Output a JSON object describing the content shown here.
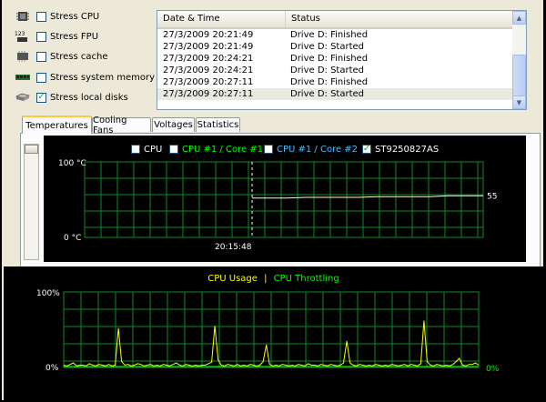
{
  "stress": {
    "items": [
      {
        "label": "Stress CPU",
        "checked": false,
        "icon": "cpu-chip-icon"
      },
      {
        "label": "Stress FPU",
        "checked": false,
        "icon": "fpu-icon"
      },
      {
        "label": "Stress cache",
        "checked": false,
        "icon": "cache-chip-icon"
      },
      {
        "label": "Stress system memory",
        "checked": false,
        "icon": "memory-module-icon"
      },
      {
        "label": "Stress local disks",
        "checked": true,
        "icon": "hard-disk-icon"
      }
    ]
  },
  "log": {
    "columns": [
      "Date & Time",
      "Status"
    ],
    "rows": [
      {
        "time": "27/3/2009 20:21:49",
        "status": "Drive D: Finished"
      },
      {
        "time": "27/3/2009 20:21:49",
        "status": "Drive D: Started"
      },
      {
        "time": "27/3/2009 20:24:21",
        "status": "Drive D: Finished"
      },
      {
        "time": "27/3/2009 20:24:21",
        "status": "Drive D: Started"
      },
      {
        "time": "27/3/2009 20:27:11",
        "status": "Drive D: Finished"
      },
      {
        "time": "27/3/2009 20:27:11",
        "status": "Drive D: Started"
      }
    ],
    "selected_row": 5
  },
  "tabs": [
    "Temperatures",
    "Cooling Fans",
    "Voltages",
    "Statistics"
  ],
  "active_tab": 0,
  "fpu_icon_text": "123",
  "temperature_graph": {
    "legend": [
      {
        "label": "CPU",
        "checked": false,
        "color": "#ffffff"
      },
      {
        "label": "CPU #1 / Core #1",
        "checked": false,
        "color": "#00ff00"
      },
      {
        "label": "CPU #1 / Core #2",
        "checked": false,
        "color": "#40c0ff"
      },
      {
        "label": "ST9250827AS",
        "checked": true,
        "color": "#ffffff"
      }
    ],
    "y_max_label": "100 °C",
    "y_min_label": "0 °C",
    "x_marker_label": "20:15:48",
    "current_value_label": "55",
    "line_color": "#ffffc0"
  },
  "cpu_graph": {
    "legend_usage": "CPU Usage",
    "legend_separator": "|",
    "legend_throttling": "CPU Throttling",
    "usage_color": "#ffff00",
    "throttling_color": "#00ff00",
    "y_max_label": "100%",
    "y_min_label": "0%",
    "throttling_value_label": "0%"
  },
  "chart_data": [
    {
      "type": "line",
      "title": "",
      "legend": [
        "CPU",
        "CPU #1 / Core #1",
        "CPU #1 / Core #2",
        "ST9250827AS"
      ],
      "ylim": [
        0,
        100
      ],
      "y_tick_labels": [
        "100 °C",
        "0 °C"
      ],
      "x_tick_labels": [
        "20:15:48"
      ],
      "series": [
        {
          "name": "ST9250827AS",
          "values": [
            52,
            52,
            52,
            53,
            53,
            53,
            53,
            54,
            54,
            54,
            54,
            55,
            55,
            55
          ]
        }
      ]
    },
    {
      "type": "line",
      "title": "",
      "legend": [
        "CPU Usage",
        "CPU Throttling"
      ],
      "ylim": [
        0,
        100
      ],
      "y_tick_labels": [
        "100%",
        "0%"
      ],
      "series": [
        {
          "name": "CPU Usage",
          "values": [
            3,
            2,
            4,
            6,
            2,
            3,
            3,
            2,
            5,
            3,
            2,
            4,
            3,
            2,
            4,
            2,
            3,
            52,
            8,
            3,
            4,
            2,
            3,
            5,
            4,
            2,
            3,
            4,
            2,
            3,
            2,
            4,
            3,
            2,
            4,
            6,
            3,
            2,
            4,
            3,
            2,
            3,
            2,
            3,
            3,
            5,
            7,
            55,
            10,
            3,
            2,
            4,
            3,
            2,
            4,
            2,
            3,
            2,
            4,
            3,
            2,
            3,
            8,
            30,
            4,
            2,
            3,
            2,
            4,
            3,
            2,
            3,
            2,
            4,
            3,
            2,
            5,
            3,
            3,
            2,
            4,
            3,
            2,
            4,
            3,
            2,
            3,
            6,
            35,
            6,
            3,
            2,
            4,
            3,
            2,
            3,
            2,
            4,
            3,
            2,
            3,
            2,
            4,
            3,
            2,
            3,
            4,
            2,
            4,
            3,
            2,
            5,
            62,
            8,
            3,
            2,
            4,
            3,
            2,
            3,
            2,
            4,
            8,
            12,
            3,
            2,
            4,
            4,
            6,
            3
          ]
        },
        {
          "name": "CPU Throttling",
          "values": [
            0,
            0,
            0,
            0,
            0,
            0,
            0,
            0,
            0,
            0,
            0,
            0
          ]
        }
      ]
    }
  ]
}
